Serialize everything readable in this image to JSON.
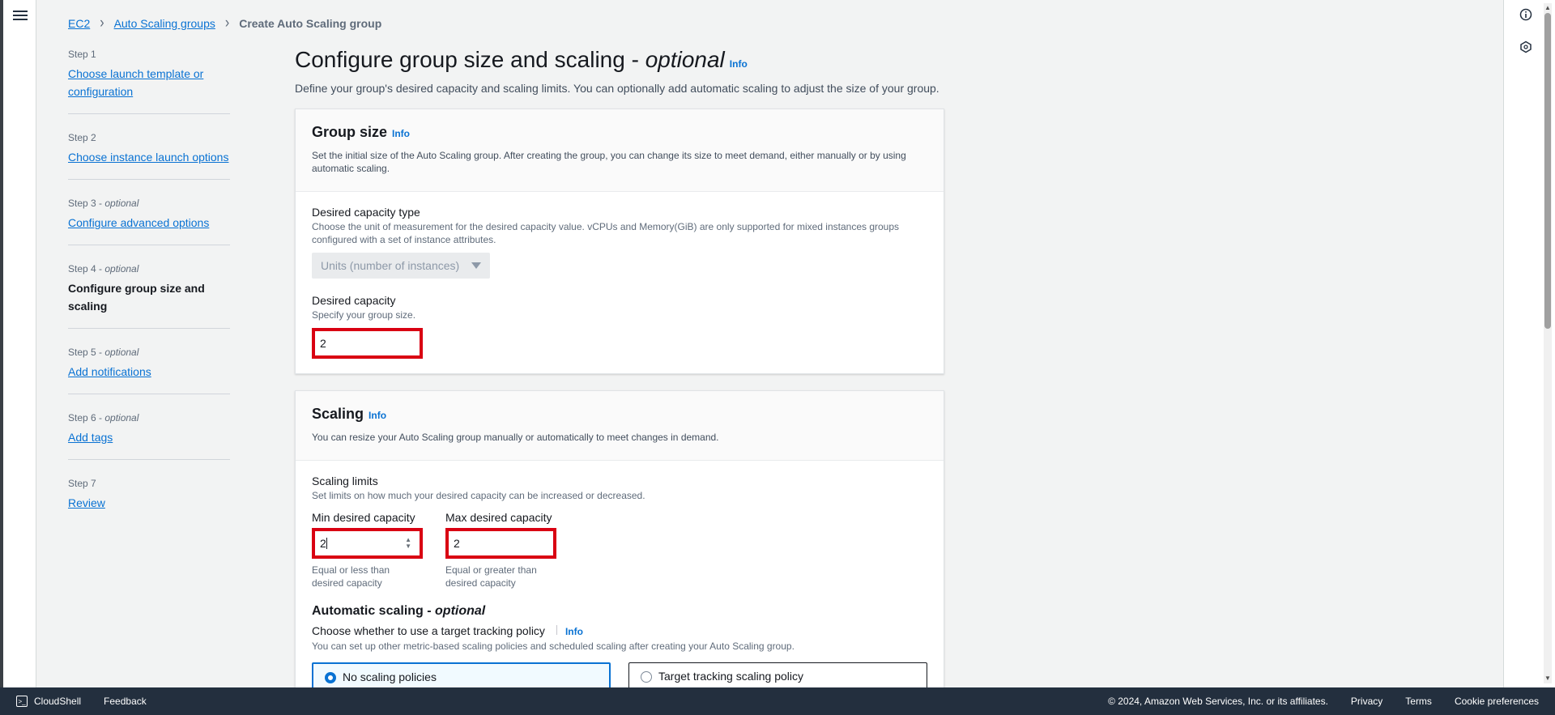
{
  "breadcrumb": {
    "ec2": "EC2",
    "asg": "Auto Scaling groups",
    "current": "Create Auto Scaling group"
  },
  "steps": [
    {
      "num": "Step 1",
      "optional": "",
      "label": "Choose launch template or configuration"
    },
    {
      "num": "Step 2",
      "optional": "",
      "label": "Choose instance launch options"
    },
    {
      "num": "Step 3 - ",
      "optional": "optional",
      "label": "Configure advanced options"
    },
    {
      "num": "Step 4 - ",
      "optional": "optional",
      "label": "Configure group size and scaling"
    },
    {
      "num": "Step 5 - ",
      "optional": "optional",
      "label": "Add notifications"
    },
    {
      "num": "Step 6 - ",
      "optional": "optional",
      "label": "Add tags"
    },
    {
      "num": "Step 7",
      "optional": "",
      "label": "Review"
    }
  ],
  "page": {
    "title": "Configure group size and scaling - ",
    "title_optional": "optional",
    "info": "Info",
    "description": "Define your group's desired capacity and scaling limits. You can optionally add automatic scaling to adjust the size of your group."
  },
  "group_size": {
    "title": "Group size",
    "info": "Info",
    "subtitle": "Set the initial size of the Auto Scaling group. After creating the group, you can change its size to meet demand, either manually or by using automatic scaling.",
    "capacity_type_label": "Desired capacity type",
    "capacity_type_hint": "Choose the unit of measurement for the desired capacity value. vCPUs and Memory(GiB) are only supported for mixed instances groups configured with a set of instance attributes.",
    "capacity_type_value": "Units (number of instances)",
    "desired_label": "Desired capacity",
    "desired_hint": "Specify your group size.",
    "desired_value": "2"
  },
  "scaling": {
    "title": "Scaling",
    "info": "Info",
    "subtitle": "You can resize your Auto Scaling group manually or automatically to meet changes in demand.",
    "limits_label": "Scaling limits",
    "limits_hint": "Set limits on how much your desired capacity can be increased or decreased.",
    "min_label": "Min desired capacity",
    "min_value": "2",
    "min_hint": "Equal or less than desired capacity",
    "max_label": "Max desired capacity",
    "max_value": "2",
    "max_hint": "Equal or greater than desired capacity",
    "auto_title": "Automatic scaling - ",
    "auto_optional": "optional",
    "policy_label": "Choose whether to use a target tracking policy",
    "policy_info": "Info",
    "policy_hint": "You can set up other metric-based scaling policies and scheduled scaling after creating your Auto Scaling group.",
    "option_no": "No scaling policies",
    "option_target": "Target tracking scaling policy"
  },
  "footer": {
    "cloudshell": "CloudShell",
    "feedback": "Feedback",
    "copyright": "© 2024, Amazon Web Services, Inc. or its affiliates.",
    "privacy": "Privacy",
    "terms": "Terms",
    "cookies": "Cookie preferences"
  },
  "icons": {
    "menu": "hamburger-menu-icon",
    "info": "info-circle-icon",
    "settings": "hexagon-icon",
    "cloudshell": "terminal-icon"
  }
}
